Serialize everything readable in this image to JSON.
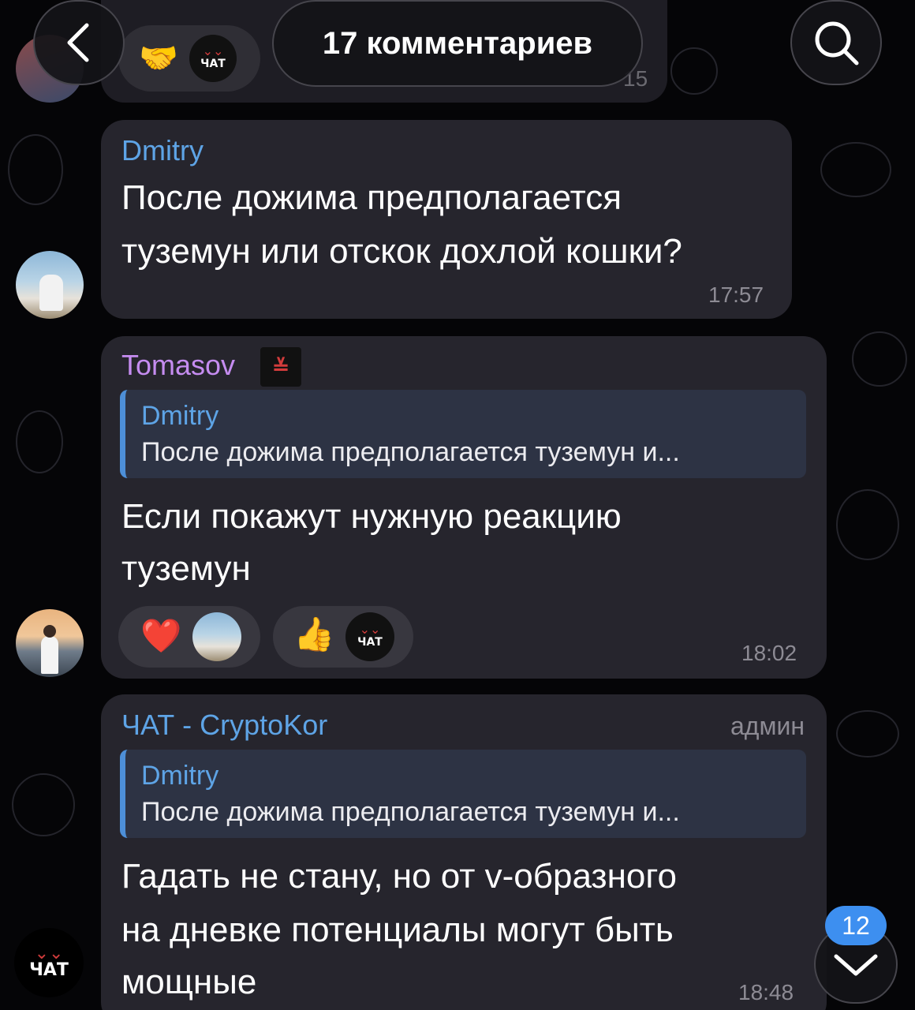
{
  "header": {
    "title": "17 комментариев",
    "back_icon": "chevron-left-icon",
    "search_icon": "search-icon"
  },
  "prev_message": {
    "time_partial": "15",
    "reaction_emoji": "🤝",
    "chat_logo_text": "ЧАТ"
  },
  "messages": [
    {
      "author": "Dmitry",
      "author_color": "#5ea4e6",
      "text_lines": [
        "После дожима предполагается",
        "туземун или отскок дохлой кошки?"
      ],
      "time": "17:57"
    },
    {
      "author": "Tomasov",
      "author_color": "#c58cf0",
      "reply": {
        "author": "Dmitry",
        "text": "После дожима предполагается туземун и..."
      },
      "text_lines": [
        "Если покажут нужную реакцию",
        "туземун"
      ],
      "reactions": [
        {
          "emoji": "❤️",
          "icon": "heart-icon"
        },
        {
          "emoji": "👍",
          "icon": "thumbs-up-icon",
          "chat_logo_text": "ЧАТ"
        }
      ],
      "time": "18:02"
    },
    {
      "author": "ЧАТ - CryptoKor",
      "author_color": "#5ea4e6",
      "role": "админ",
      "reply": {
        "author": "Dmitry",
        "text": "После дожима предполагается туземун и..."
      },
      "text_lines": [
        "Гадать не стану, но от v-образного",
        "на дневке потенциалы могут быть",
        "мощные"
      ],
      "time": "18:48"
    }
  ],
  "sidebar": {
    "chat_avatar_text": "ЧАТ"
  },
  "scroll_down": {
    "unread_count": "12",
    "icon": "chevron-down-icon"
  },
  "colors": {
    "accent": "#4d8fd8",
    "badge": "#3d8ff0",
    "bubble": "#26252d"
  }
}
